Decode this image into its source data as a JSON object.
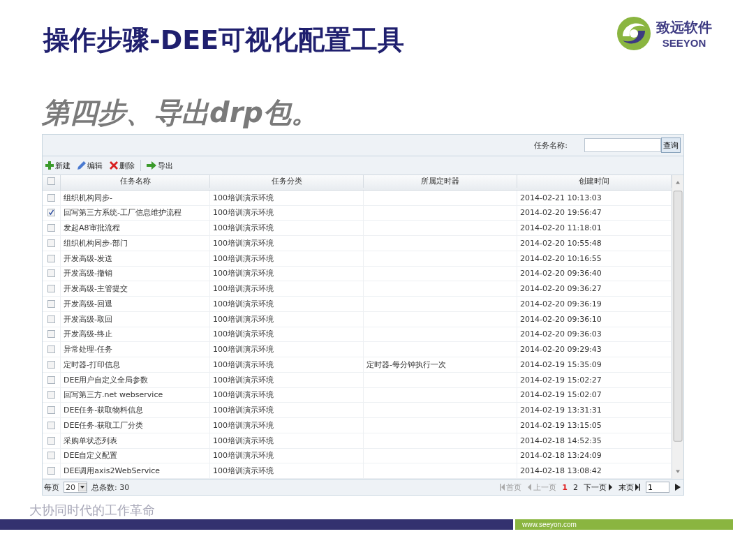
{
  "slide": {
    "title": "操作步骤-DEE可视化配置工具",
    "subtitle": "第四步、导出drp包。",
    "logo": {
      "name": "致远软件",
      "brand": "SEEYON"
    },
    "slogan": "大协同时代的工作革命",
    "url": "www.seeyon.com"
  },
  "search": {
    "label": "任务名称:",
    "button": "查询"
  },
  "toolbar": [
    {
      "label": "新建"
    },
    {
      "label": "编辑"
    },
    {
      "label": "删除"
    },
    {
      "label": "导出"
    }
  ],
  "table": {
    "select_all": {
      "checked": false
    },
    "columns": [
      "任务名称",
      "任务分类",
      "所属定时器",
      "创建时间"
    ],
    "rows": [
      {
        "checked": false,
        "cells": [
          "组织机构同步-",
          "100培训演示环境",
          "",
          "2014-02-21 10:13:03"
        ]
      },
      {
        "checked": true,
        "cells": [
          "回写第三方系统-工厂信息维护流程",
          "100培训演示环境",
          "",
          "2014-02-20 19:56:47"
        ]
      },
      {
        "checked": false,
        "cells": [
          "发起A8审批流程",
          "100培训演示环境",
          "",
          "2014-02-20 11:18:01"
        ]
      },
      {
        "checked": false,
        "cells": [
          "组织机构同步-部门",
          "100培训演示环境",
          "",
          "2014-02-20 10:55:48"
        ]
      },
      {
        "checked": false,
        "cells": [
          "开发高级-发送",
          "100培训演示环境",
          "",
          "2014-02-20 10:16:55"
        ]
      },
      {
        "checked": false,
        "cells": [
          "开发高级-撤销",
          "100培训演示环境",
          "",
          "2014-02-20 09:36:40"
        ]
      },
      {
        "checked": false,
        "cells": [
          "开发高级-主管提交",
          "100培训演示环境",
          "",
          "2014-02-20 09:36:27"
        ]
      },
      {
        "checked": false,
        "cells": [
          "开发高级-回退",
          "100培训演示环境",
          "",
          "2014-02-20 09:36:19"
        ]
      },
      {
        "checked": false,
        "cells": [
          "开发高级-取回",
          "100培训演示环境",
          "",
          "2014-02-20 09:36:10"
        ]
      },
      {
        "checked": false,
        "cells": [
          "开发高级-终止",
          "100培训演示环境",
          "",
          "2014-02-20 09:36:03"
        ]
      },
      {
        "checked": false,
        "cells": [
          "异常处理-任务",
          "100培训演示环境",
          "",
          "2014-02-20 09:29:43"
        ]
      },
      {
        "checked": false,
        "cells": [
          "定时器-打印信息",
          "100培训演示环境",
          "定时器-每分钟执行一次",
          "2014-02-19 15:35:09"
        ]
      },
      {
        "checked": false,
        "cells": [
          "DEE用户自定义全局参数",
          "100培训演示环境",
          "",
          "2014-02-19 15:02:27"
        ]
      },
      {
        "checked": false,
        "cells": [
          "回写第三方.net webservice",
          "100培训演示环境",
          "",
          "2014-02-19 15:02:07"
        ]
      },
      {
        "checked": false,
        "cells": [
          "DEE任务-获取物料信息",
          "100培训演示环境",
          "",
          "2014-02-19 13:31:31"
        ]
      },
      {
        "checked": false,
        "cells": [
          "DEE任务-获取工厂分类",
          "100培训演示环境",
          "",
          "2014-02-19 13:15:05"
        ]
      },
      {
        "checked": false,
        "cells": [
          "采购单状态列表",
          "100培训演示环境",
          "",
          "2014-02-18 14:52:35"
        ]
      },
      {
        "checked": false,
        "cells": [
          "DEE自定义配置",
          "100培训演示环境",
          "",
          "2014-02-18 13:24:09"
        ]
      },
      {
        "checked": false,
        "cells": [
          "DEE调用axis2WebService",
          "100培训演示环境",
          "",
          "2014-02-18 13:08:42"
        ]
      }
    ]
  },
  "pager": {
    "per_page_label": "每页",
    "per_page": "20",
    "total": "总条数: 30",
    "nav": [
      {
        "label": "首页",
        "kind": "first",
        "disabled": true
      },
      {
        "label": "上一页",
        "kind": "prev",
        "disabled": true
      }
    ],
    "pages": [
      {
        "label": "1",
        "selected": true
      },
      {
        "label": "2",
        "selected": false
      }
    ],
    "nav_after": [
      {
        "label": "下一页",
        "kind": "next",
        "disabled": false
      },
      {
        "label": "末页",
        "kind": "last",
        "disabled": false
      }
    ],
    "page_input": "1"
  }
}
